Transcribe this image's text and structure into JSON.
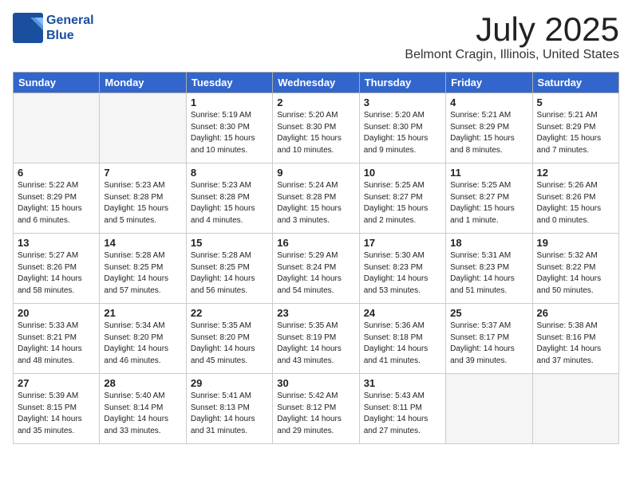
{
  "logo": {
    "line1": "General",
    "line2": "Blue"
  },
  "title": "July 2025",
  "location": "Belmont Cragin, Illinois, United States",
  "headers": [
    "Sunday",
    "Monday",
    "Tuesday",
    "Wednesday",
    "Thursday",
    "Friday",
    "Saturday"
  ],
  "weeks": [
    [
      {
        "day": "",
        "info": ""
      },
      {
        "day": "",
        "info": ""
      },
      {
        "day": "1",
        "info": "Sunrise: 5:19 AM\nSunset: 8:30 PM\nDaylight: 15 hours\nand 10 minutes."
      },
      {
        "day": "2",
        "info": "Sunrise: 5:20 AM\nSunset: 8:30 PM\nDaylight: 15 hours\nand 10 minutes."
      },
      {
        "day": "3",
        "info": "Sunrise: 5:20 AM\nSunset: 8:30 PM\nDaylight: 15 hours\nand 9 minutes."
      },
      {
        "day": "4",
        "info": "Sunrise: 5:21 AM\nSunset: 8:29 PM\nDaylight: 15 hours\nand 8 minutes."
      },
      {
        "day": "5",
        "info": "Sunrise: 5:21 AM\nSunset: 8:29 PM\nDaylight: 15 hours\nand 7 minutes."
      }
    ],
    [
      {
        "day": "6",
        "info": "Sunrise: 5:22 AM\nSunset: 8:29 PM\nDaylight: 15 hours\nand 6 minutes."
      },
      {
        "day": "7",
        "info": "Sunrise: 5:23 AM\nSunset: 8:28 PM\nDaylight: 15 hours\nand 5 minutes."
      },
      {
        "day": "8",
        "info": "Sunrise: 5:23 AM\nSunset: 8:28 PM\nDaylight: 15 hours\nand 4 minutes."
      },
      {
        "day": "9",
        "info": "Sunrise: 5:24 AM\nSunset: 8:28 PM\nDaylight: 15 hours\nand 3 minutes."
      },
      {
        "day": "10",
        "info": "Sunrise: 5:25 AM\nSunset: 8:27 PM\nDaylight: 15 hours\nand 2 minutes."
      },
      {
        "day": "11",
        "info": "Sunrise: 5:25 AM\nSunset: 8:27 PM\nDaylight: 15 hours\nand 1 minute."
      },
      {
        "day": "12",
        "info": "Sunrise: 5:26 AM\nSunset: 8:26 PM\nDaylight: 15 hours\nand 0 minutes."
      }
    ],
    [
      {
        "day": "13",
        "info": "Sunrise: 5:27 AM\nSunset: 8:26 PM\nDaylight: 14 hours\nand 58 minutes."
      },
      {
        "day": "14",
        "info": "Sunrise: 5:28 AM\nSunset: 8:25 PM\nDaylight: 14 hours\nand 57 minutes."
      },
      {
        "day": "15",
        "info": "Sunrise: 5:28 AM\nSunset: 8:25 PM\nDaylight: 14 hours\nand 56 minutes."
      },
      {
        "day": "16",
        "info": "Sunrise: 5:29 AM\nSunset: 8:24 PM\nDaylight: 14 hours\nand 54 minutes."
      },
      {
        "day": "17",
        "info": "Sunrise: 5:30 AM\nSunset: 8:23 PM\nDaylight: 14 hours\nand 53 minutes."
      },
      {
        "day": "18",
        "info": "Sunrise: 5:31 AM\nSunset: 8:23 PM\nDaylight: 14 hours\nand 51 minutes."
      },
      {
        "day": "19",
        "info": "Sunrise: 5:32 AM\nSunset: 8:22 PM\nDaylight: 14 hours\nand 50 minutes."
      }
    ],
    [
      {
        "day": "20",
        "info": "Sunrise: 5:33 AM\nSunset: 8:21 PM\nDaylight: 14 hours\nand 48 minutes."
      },
      {
        "day": "21",
        "info": "Sunrise: 5:34 AM\nSunset: 8:20 PM\nDaylight: 14 hours\nand 46 minutes."
      },
      {
        "day": "22",
        "info": "Sunrise: 5:35 AM\nSunset: 8:20 PM\nDaylight: 14 hours\nand 45 minutes."
      },
      {
        "day": "23",
        "info": "Sunrise: 5:35 AM\nSunset: 8:19 PM\nDaylight: 14 hours\nand 43 minutes."
      },
      {
        "day": "24",
        "info": "Sunrise: 5:36 AM\nSunset: 8:18 PM\nDaylight: 14 hours\nand 41 minutes."
      },
      {
        "day": "25",
        "info": "Sunrise: 5:37 AM\nSunset: 8:17 PM\nDaylight: 14 hours\nand 39 minutes."
      },
      {
        "day": "26",
        "info": "Sunrise: 5:38 AM\nSunset: 8:16 PM\nDaylight: 14 hours\nand 37 minutes."
      }
    ],
    [
      {
        "day": "27",
        "info": "Sunrise: 5:39 AM\nSunset: 8:15 PM\nDaylight: 14 hours\nand 35 minutes."
      },
      {
        "day": "28",
        "info": "Sunrise: 5:40 AM\nSunset: 8:14 PM\nDaylight: 14 hours\nand 33 minutes."
      },
      {
        "day": "29",
        "info": "Sunrise: 5:41 AM\nSunset: 8:13 PM\nDaylight: 14 hours\nand 31 minutes."
      },
      {
        "day": "30",
        "info": "Sunrise: 5:42 AM\nSunset: 8:12 PM\nDaylight: 14 hours\nand 29 minutes."
      },
      {
        "day": "31",
        "info": "Sunrise: 5:43 AM\nSunset: 8:11 PM\nDaylight: 14 hours\nand 27 minutes."
      },
      {
        "day": "",
        "info": ""
      },
      {
        "day": "",
        "info": ""
      }
    ]
  ]
}
